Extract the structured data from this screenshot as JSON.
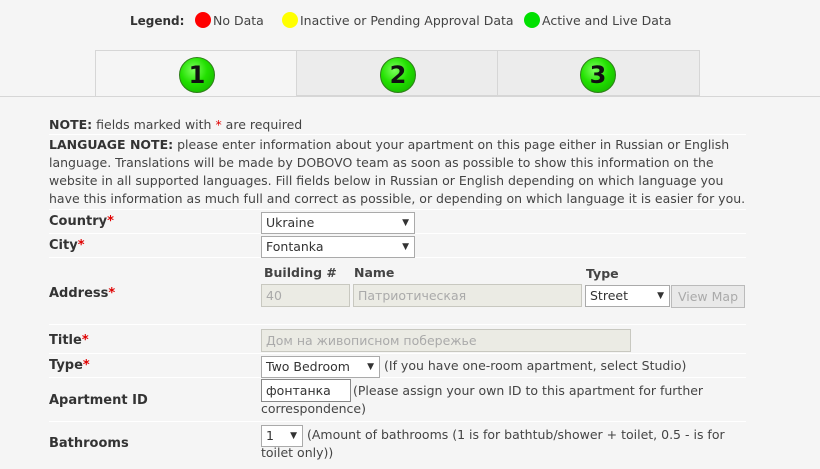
{
  "legend": {
    "label": "Legend:",
    "items": [
      {
        "label": "No Data",
        "color": "#ff0000"
      },
      {
        "label": "Inactive or Pending Approval Data",
        "color": "#ffff00"
      },
      {
        "label": "Active and Live Data",
        "color": "#00e000"
      }
    ]
  },
  "tabs": [
    {
      "number": "1",
      "active": true
    },
    {
      "number": "2",
      "active": false
    },
    {
      "number": "3",
      "active": false
    }
  ],
  "notes": {
    "note_label": "NOTE:",
    "note_text_before": " fields marked with ",
    "note_star": "*",
    "note_text_after": " are required",
    "lang_label": "LANGUAGE NOTE:",
    "lang_text": " please enter information about your apartment on this page either in Russian or English language. Translations will be made by DOBOVO team as soon as possible to show this information on the website in all supported languages. Fill fields below in Russian or English depending on which language you have this information as much full and correct as possible, or depending on which language it is easier for you."
  },
  "form": {
    "country": {
      "label": "Country",
      "star": "*",
      "value": "Ukraine"
    },
    "city": {
      "label": "City",
      "star": "*",
      "value": "Fontanka"
    },
    "address": {
      "label": "Address",
      "star": "*",
      "building_label": "Building #",
      "building_value": "40",
      "name_label": "Name",
      "name_value": "Патриотическая",
      "type_label": "Type",
      "type_value": "Street",
      "view_map": "View Map"
    },
    "title": {
      "label": "Title",
      "star": "*",
      "value": "Дом на живописном побережье"
    },
    "type": {
      "label": "Type",
      "star": "*",
      "value": "Two Bedroom",
      "hint": "(If you have one-room apartment, select Studio)"
    },
    "apartment_id": {
      "label": "Apartment ID",
      "value": "фонтанка",
      "hint": "(Please assign your own ID to this apartment for further correspondence)"
    },
    "bathrooms": {
      "label": "Bathrooms",
      "value": "1",
      "hint": "(Amount of bathrooms (1 is for bathtub/shower + toilet, 0.5 - is for toilet only))"
    }
  },
  "icons": {
    "dropdown_arrow": "▼"
  }
}
